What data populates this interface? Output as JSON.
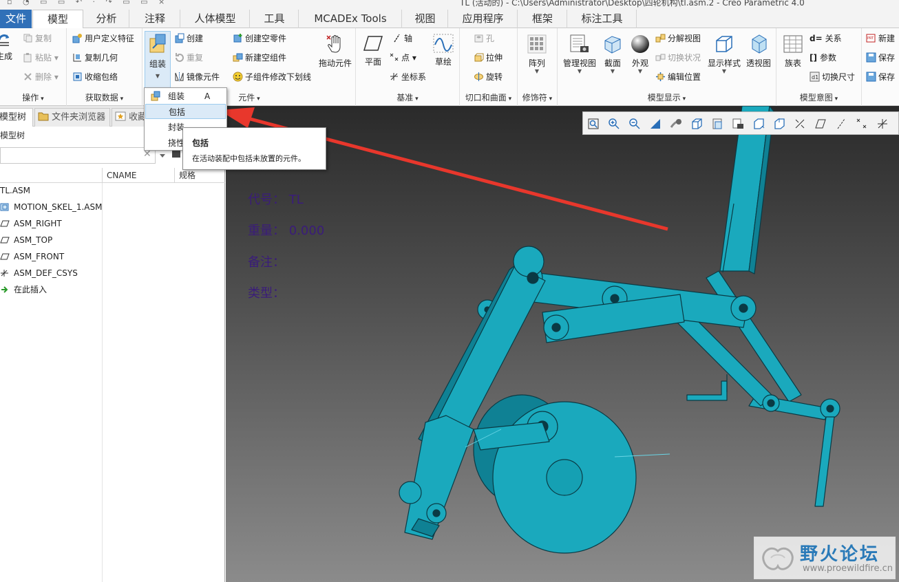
{
  "titlebar": {
    "quick_access": "▫ ◔ ▭ ▭ ↶ · ↷ ▭ ▭ ×",
    "title": "TL (活动的) - C:\\Users\\Administrator\\Desktop\\四轮机构\\tl.asm.2 - Creo Parametric 4.0"
  },
  "tabs": [
    {
      "label": "文件"
    },
    {
      "label": "模型"
    },
    {
      "label": "分析"
    },
    {
      "label": "注释"
    },
    {
      "label": "人体模型"
    },
    {
      "label": "工具"
    },
    {
      "label": "MCADEx Tools"
    },
    {
      "label": "视图"
    },
    {
      "label": "应用程序"
    },
    {
      "label": "框架"
    },
    {
      "label": "标注工具"
    }
  ],
  "ribbon": {
    "operations": {
      "regen": "生成",
      "copy": "复制",
      "paste": "粘贴",
      "delete": "删除",
      "label": "操作"
    },
    "get_data": {
      "udf": "用户定义特征",
      "copy_geom": "复制几何",
      "shrinkwrap": "收缩包络",
      "label": "获取数据"
    },
    "component": {
      "assemble": "组装",
      "create": "创建",
      "repeat": "重复",
      "mirror": "镜像元件",
      "new_part": "创建空零件",
      "new_subasm": "新建空组件",
      "underline": "子组件修改下划线",
      "drag": "拖动元件",
      "label": "元件"
    },
    "datum": {
      "plane": "平面",
      "axis": "轴",
      "point": "点",
      "csys": "坐标系",
      "sketch": "草绘",
      "label": "基准"
    },
    "cut_surface": {
      "hole": "孔",
      "extrude": "拉伸",
      "revolve": "旋转",
      "label": "切口和曲面"
    },
    "modifiers": {
      "pattern": "阵列",
      "label": "修饰符"
    },
    "model_display": {
      "manage_views": "管理视图",
      "section": "截面",
      "appearance": "外观",
      "explode": "分解视图",
      "toggle_status": "切换状况",
      "edit_position": "编辑位置",
      "display_style": "显示样式",
      "perspective": "透视图",
      "label": "模型显示"
    },
    "model_intent": {
      "family": "族表",
      "relations": "关系",
      "params": "参数",
      "toggle_dims": "切换尺寸",
      "label": "模型意图"
    },
    "more": {
      "new1": "新建",
      "save1": "保存",
      "save2": "保存"
    }
  },
  "panel": {
    "tabs": [
      {
        "label": "模型树"
      },
      {
        "label": "文件夹浏览器"
      },
      {
        "label": "收藏"
      }
    ],
    "tree_title": "模型树",
    "columns": [
      "CNAME",
      "规格"
    ],
    "rows": [
      {
        "label": "TL.ASM",
        "icon": "assembly-icon"
      },
      {
        "label": "MOTION_SKEL_1.ASM",
        "icon": "skeleton-icon"
      },
      {
        "label": "ASM_RIGHT",
        "icon": "datum-plane-icon"
      },
      {
        "label": "ASM_TOP",
        "icon": "datum-plane-icon"
      },
      {
        "label": "ASM_FRONT",
        "icon": "datum-plane-icon"
      },
      {
        "label": "ASM_DEF_CSYS",
        "icon": "csys-icon"
      },
      {
        "label": "在此插入",
        "icon": "insert-here-icon"
      }
    ]
  },
  "dropdown": {
    "items": [
      {
        "label": "组装",
        "shortcut": "A"
      },
      {
        "label": "包括"
      },
      {
        "label": "封装"
      },
      {
        "label": "挠性"
      }
    ]
  },
  "tooltip": {
    "title": "包括",
    "desc": "在活动装配中包括未放置的元件。"
  },
  "viewport": {
    "info": [
      {
        "label": "代号：",
        "value": "TL"
      },
      {
        "label": "重量：",
        "value": "0.000"
      },
      {
        "label": "备注：",
        "value": ""
      },
      {
        "label": "类型：",
        "value": ""
      }
    ],
    "model_color": "#19b4c8",
    "arrow_color": "#e8372c"
  },
  "watermark": {
    "text": "野火论坛",
    "url": "www.proewildfire.cn"
  }
}
